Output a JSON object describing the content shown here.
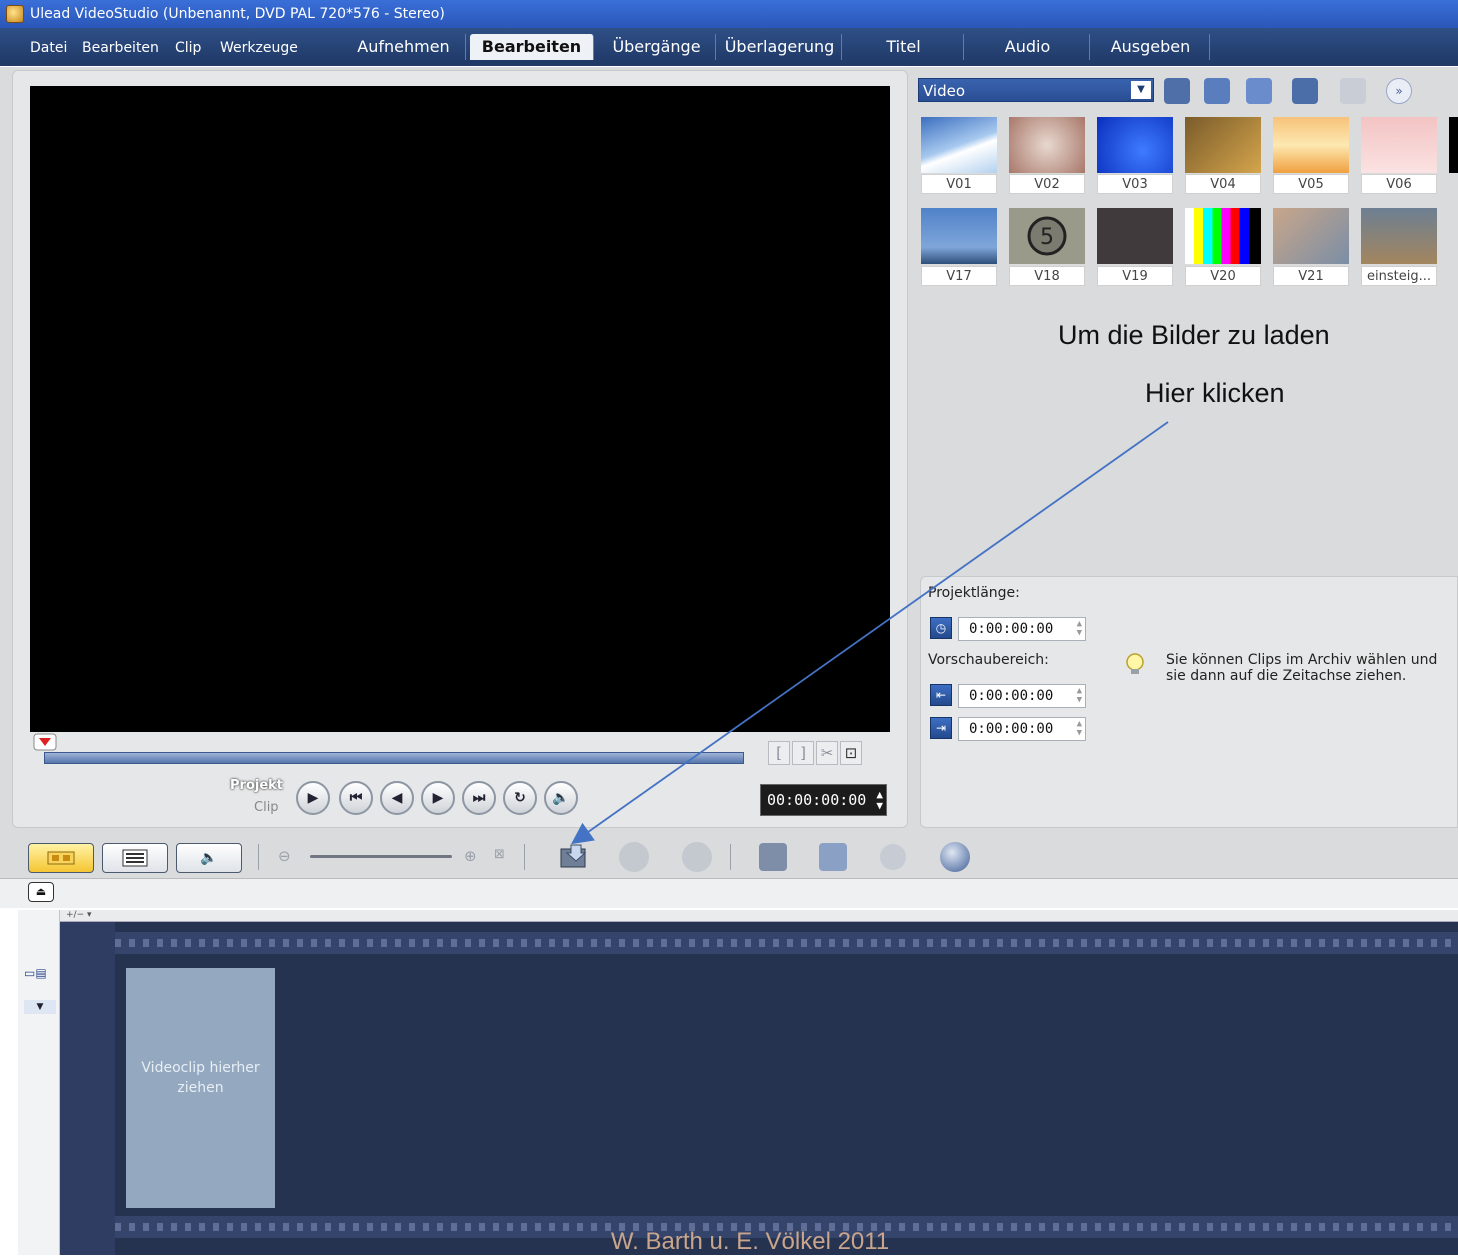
{
  "window": {
    "title": "Ulead VideoStudio (Unbenannt, DVD PAL 720*576 - Stereo)"
  },
  "menu": {
    "items": [
      "Datei",
      "Bearbeiten",
      "Clip",
      "Werkzeuge"
    ]
  },
  "tabs": [
    {
      "label": "Aufnehmen",
      "active": false
    },
    {
      "label": "Bearbeiten",
      "active": true
    },
    {
      "label": "Übergänge",
      "active": false
    },
    {
      "label": "Überlagerung",
      "active": false
    },
    {
      "label": "Titel",
      "active": false
    },
    {
      "label": "Audio",
      "active": false
    },
    {
      "label": "Ausgeben",
      "active": false
    }
  ],
  "player": {
    "mode_project": "Projekt",
    "mode_clip": "Clip",
    "timecode": "00:00:00:00",
    "mark_in": "[",
    "mark_out": "]"
  },
  "library": {
    "category": "Video",
    "clips": [
      "V01",
      "V02",
      "V03",
      "V04",
      "V05",
      "V06",
      "V17",
      "V18",
      "V19",
      "V20",
      "V21",
      "einsteig..."
    ]
  },
  "project_info": {
    "length_label": "Projektlänge:",
    "length_value": "0:00:00:00",
    "preview_label": "Vorschaubereich:",
    "preview_start": "0:00:00:00",
    "preview_end": "0:00:00:00",
    "tip": "Sie können Clips im Archiv wählen und sie dann auf die Zeitachse ziehen."
  },
  "annotation": {
    "line1": "Um die Bilder zu laden",
    "line2": "Hier klicken"
  },
  "timeline": {
    "ruler_label": "+/− ▾",
    "dropzone_text": "Videoclip hierher ziehen"
  },
  "footer": "W. Barth u. E. Völkel 2011",
  "colors": {
    "menubar": "#2a4a80",
    "timeline_bg": "#253250",
    "active_view": "#f5c533",
    "annotation_arrow": "#4472c4"
  }
}
